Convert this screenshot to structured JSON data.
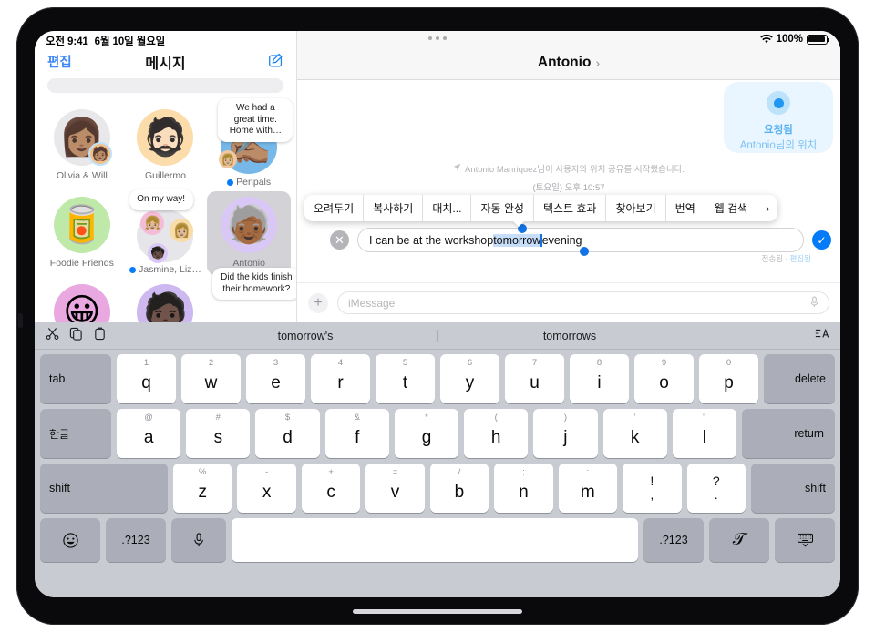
{
  "status": {
    "time": "오전 9:41",
    "date": "6월 10일 월요일",
    "battery_pct": "100%",
    "wifi_icon": "wifi-icon",
    "battery_icon": "battery-icon"
  },
  "sidebar": {
    "edit_label": "편집",
    "title": "메시지",
    "compose_icon": "compose-icon",
    "search_placeholder": "",
    "contacts": [
      {
        "name": "Olivia & Will",
        "unread": false,
        "avatar_bg": "#e8e8ea",
        "emoji": "👩🏽",
        "sub_emoji": "🧑🏽",
        "preview": ""
      },
      {
        "name": "Guillermo",
        "unread": false,
        "avatar_bg": "#fcdcab",
        "emoji": "🧔🏻",
        "preview": ""
      },
      {
        "name": "Penpals",
        "unread": true,
        "avatar_bg": "#76b8e8",
        "emoji": "✍🏽",
        "preview": "We had a great time. Home with…"
      },
      {
        "name": "Foodie Friends",
        "unread": false,
        "avatar_bg": "#bfe9a8",
        "emoji": "🥫",
        "preview": ""
      },
      {
        "name": "Jasmine, Liz…",
        "unread": true,
        "avatar_bg": "#e6e6ea",
        "emoji": "",
        "preview": "On my way!"
      },
      {
        "name": "Antonio",
        "unread": false,
        "avatar_bg": "#d9c8f5",
        "emoji": "🧓🏾",
        "preview": "Did the kids finish their homework?",
        "selected": true
      },
      {
        "name": "",
        "unread": false,
        "avatar_bg": "#e9a8e0",
        "emoji": "😀",
        "preview": ""
      },
      {
        "name": "",
        "unread": false,
        "avatar_bg": "#cdb8f0",
        "emoji": "🧑🏿",
        "preview": ""
      }
    ]
  },
  "conversation": {
    "title": "Antonio",
    "title_chevron": "chevron-right-icon",
    "multitask_icon": "multitask-dots-icon",
    "location_bubble": {
      "status": "요청됨",
      "subtitle": "Antonio님의 위치",
      "pin_icon": "location-dot-icon"
    },
    "system_message": "Antonio Manriquez님이 사용자와 위치 공유를 시작했습니다.",
    "system_icon": "location-arrow-icon",
    "timestamp": "(토요일) 오후 10:57",
    "context_menu": [
      "오려두기",
      "복사하기",
      "대치...",
      "자동 완성",
      "텍스트 효과",
      "찾아보기",
      "번역",
      "웹 검색",
      "›"
    ],
    "edit_bubble": {
      "text_before": "I can be at the workshop ",
      "selected_text": "tomorrow",
      "text_after": " evening",
      "cancel_icon": "close-circle-icon",
      "confirm_icon": "checkmark-circle-icon",
      "meta_sent": "전송됨",
      "meta_sep": " · ",
      "meta_edited": "편집됨"
    },
    "composer": {
      "plus_icon": "plus-icon",
      "placeholder": "iMessage",
      "mic_icon": "microphone-icon"
    }
  },
  "keyboard": {
    "toolbar": {
      "cut_icon": "scissors-icon",
      "copy_icon": "copy-icon",
      "paste_icon": "paste-icon",
      "format_icon": "text-format-icon",
      "suggestions": [
        "tomorrow's",
        "tomorrows"
      ]
    },
    "row1": {
      "tab": "tab",
      "delete": "delete",
      "keys": [
        {
          "alt": "1",
          "main": "q"
        },
        {
          "alt": "2",
          "main": "w"
        },
        {
          "alt": "3",
          "main": "e"
        },
        {
          "alt": "4",
          "main": "r"
        },
        {
          "alt": "5",
          "main": "t"
        },
        {
          "alt": "6",
          "main": "y"
        },
        {
          "alt": "7",
          "main": "u"
        },
        {
          "alt": "8",
          "main": "i"
        },
        {
          "alt": "9",
          "main": "o"
        },
        {
          "alt": "0",
          "main": "p"
        }
      ]
    },
    "row2": {
      "lang": "한글",
      "return": "return",
      "keys": [
        {
          "alt": "@",
          "main": "a"
        },
        {
          "alt": "#",
          "main": "s"
        },
        {
          "alt": "$",
          "main": "d"
        },
        {
          "alt": "&",
          "main": "f"
        },
        {
          "alt": "*",
          "main": "g"
        },
        {
          "alt": "(",
          "main": "h"
        },
        {
          "alt": ")",
          "main": "j"
        },
        {
          "alt": "'",
          "main": "k"
        },
        {
          "alt": "\"",
          "main": "l"
        }
      ]
    },
    "row3": {
      "shift_left": "shift",
      "shift_right": "shift",
      "keys": [
        {
          "alt": "%",
          "main": "z"
        },
        {
          "alt": "-",
          "main": "x"
        },
        {
          "alt": "+",
          "main": "c"
        },
        {
          "alt": "=",
          "main": "v"
        },
        {
          "alt": "/",
          "main": "b"
        },
        {
          "alt": ";",
          "main": "n"
        },
        {
          "alt": ":",
          "main": "m"
        }
      ],
      "punct1_up": "!",
      "punct1_dn": ",",
      "punct2_up": "?",
      "punct2_dn": "."
    },
    "row4": {
      "emoji_icon": "emoji-icon",
      "num_left": ".?123",
      "mic_icon": "microphone-icon",
      "space": "",
      "num_right": ".?123",
      "handwriting": "𝒯",
      "dismiss_icon": "keyboard-dismiss-icon"
    }
  },
  "colors": {
    "accent_blue": "#067bf7",
    "selection_blue": "#c7defa",
    "keyboard_bg": "#c9cbd3",
    "key_dark": "#abaeb8"
  }
}
